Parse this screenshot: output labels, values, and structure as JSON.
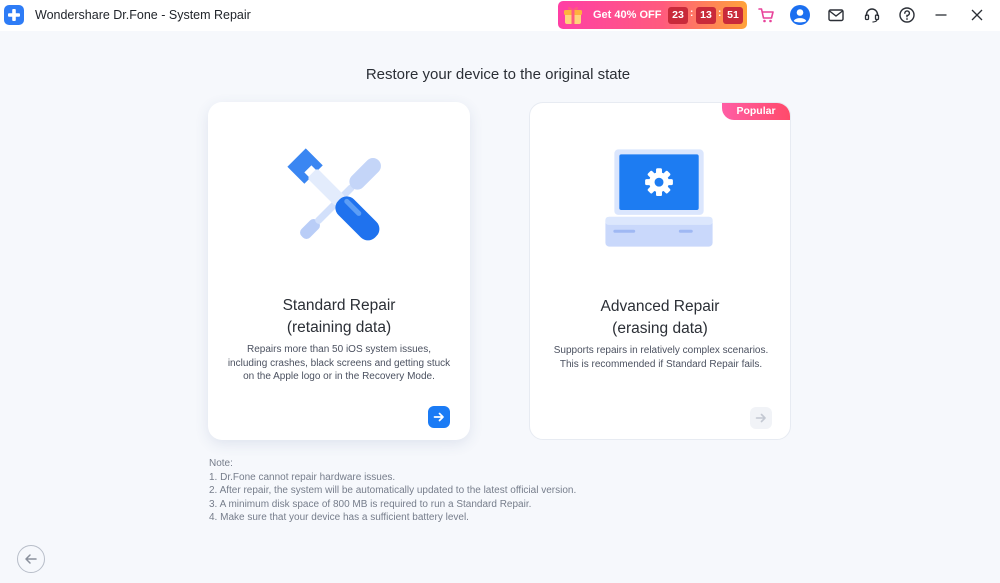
{
  "app": {
    "title": "Wondershare Dr.Fone - System Repair"
  },
  "promo": {
    "label": "Get 40% OFF",
    "countdown": [
      "23",
      "13",
      "51"
    ]
  },
  "titlebar_icons": [
    "cart-icon",
    "account-icon",
    "mail-icon",
    "support-icon",
    "help-icon",
    "minimize-icon",
    "close-icon"
  ],
  "heading": "Restore your device to the original state",
  "cards": [
    {
      "title_line1": "Standard Repair",
      "title_line2": "(retaining data)",
      "description": "Repairs more than 50 iOS system issues, including crashes, black screens and getting stuck on the Apple logo or in the Recovery Mode.",
      "icon": "tools-icon",
      "arrow": "arrow-right-icon",
      "selected": true
    },
    {
      "title_line1": "Advanced Repair",
      "title_line2": "(erasing data)",
      "description": "Supports repairs in relatively complex scenarios. This is recommended if Standard Repair fails.",
      "badge": "Popular",
      "icon": "computer-gear-icon",
      "arrow": "arrow-right-icon",
      "selected": false
    }
  ],
  "notes": {
    "label": "Note:",
    "items": [
      "1. Dr.Fone cannot repair hardware issues.",
      "2. After repair, the system will be automatically updated to the latest official version.",
      "3. A minimum disk space of 800 MB is required to run a Standard Repair.",
      "4. Make sure that your device has a sufficient battery level."
    ]
  },
  "colors": {
    "accent": "#1b7bf5",
    "promo_start": "#ff3fa5",
    "promo_end": "#ffa33a",
    "badge": "#ff4f78",
    "background": "#f6f8fc"
  }
}
